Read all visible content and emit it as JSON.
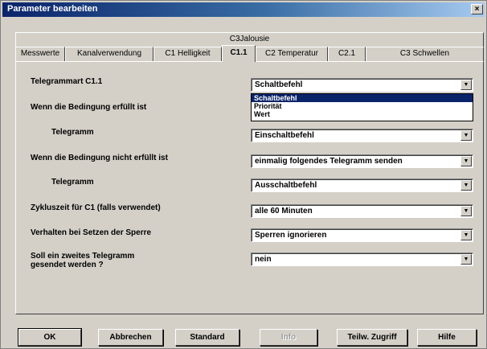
{
  "window": {
    "title": "Parameter bearbeiten",
    "close_glyph": "×"
  },
  "tabs_back": [
    {
      "label": "C3Jalousie"
    }
  ],
  "tabs_front": [
    {
      "label": "Messwerte"
    },
    {
      "label": "Kanalverwendung"
    },
    {
      "label": "C1 Helligkeit"
    },
    {
      "label": "C1.1"
    },
    {
      "label": "C2 Temperatur"
    },
    {
      "label": "C2.1"
    },
    {
      "label": "C3 Schwellen"
    }
  ],
  "active_tab": "C1.1",
  "fields": [
    {
      "label": "Telegrammart C1.1",
      "value": "Schaltbefehl"
    },
    {
      "label": "Wenn die Bedingung erfüllt ist"
    },
    {
      "label": "Telegramm",
      "value": "Einschaltbefehl"
    },
    {
      "label": "Wenn die Bedingung nicht erfüllt ist",
      "value": "einmalig folgendes Telegramm senden"
    },
    {
      "label": "Telegramm",
      "value": "Ausschaltbefehl"
    },
    {
      "label": "Zykluszeit für C1 (falls verwendet)",
      "value": "alle 60 Minuten"
    },
    {
      "label": "Verhalten bei Setzen der Sperre",
      "value": "Sperren ignorieren"
    },
    {
      "label": "Soll ein zweites Telegramm gesendet werden ?",
      "value": "nein"
    }
  ],
  "dropdown_options": [
    "Schaltbefehl",
    "Priorität",
    "Wert"
  ],
  "dropdown_selected": "Schaltbefehl",
  "buttons": {
    "ok": "OK",
    "cancel": "Abbrechen",
    "standard": "Standard",
    "info": "Info",
    "partial_access": "Teilw. Zugriff",
    "help": "Hilfe"
  },
  "colors": {
    "titlebar_start": "#0a246a",
    "selection": "#0a246a",
    "face": "#d4d0c8"
  }
}
